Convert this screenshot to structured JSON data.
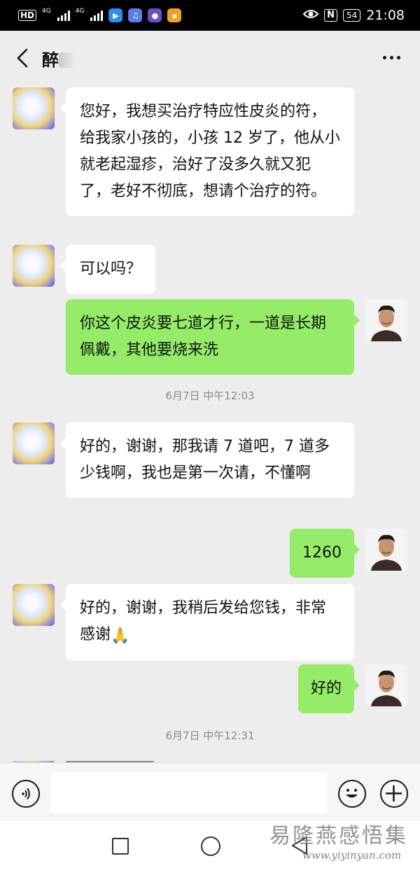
{
  "status_bar": {
    "hd": "HD",
    "net1": "4G",
    "net2": "4G",
    "nfc": "N",
    "battery": "54",
    "time": "21:08",
    "icons": [
      "hd-icon",
      "signal-icon",
      "signal-icon",
      "delivery-app-icon",
      "music-app-icon",
      "app-icon",
      "app-icon",
      "eye-icon",
      "nfc-icon",
      "battery-icon"
    ]
  },
  "header": {
    "title": "醉",
    "back_icon": "chevron-left-icon",
    "more_icon": "more-dots-icon"
  },
  "messages": [
    {
      "side": "left",
      "text": "您好，我想买治疗特应性皮炎的符，给我家小孩的，小孩 12 岁了，他从小就老起湿疹，治好了没多久就又犯了，老好不彻底，想请个治疗的符。"
    },
    {
      "side": "left",
      "text": "可以吗？"
    },
    {
      "side": "right",
      "text": "你这个皮炎要七道才行，一道是长期佩戴，其他要烧来洗"
    },
    {
      "side": "left",
      "text": "好的，谢谢，那我请 7 道吧，7 道多少钱啊，我也是第一次请，不懂啊"
    },
    {
      "side": "right",
      "text": "1260"
    },
    {
      "side": "left",
      "text": "好的，谢谢，我稍后发给您钱，非常感谢"
    },
    {
      "side": "right",
      "text": "好的"
    }
  ],
  "timestamps": [
    "6月7日 中午12:03",
    "6月7日 中午12:31"
  ],
  "emoji": "🙏",
  "input_bar": {
    "value": "",
    "voice_icon": "voice-icon",
    "emoji_icon": "smiley-icon",
    "plus_icon": "plus-icon"
  },
  "nav_bar": {
    "icons": [
      "recent-apps-icon",
      "home-icon",
      "back-triangle-icon"
    ]
  },
  "watermark": {
    "title": "易隆燕感悟集",
    "url": "www.yiyinyan.com"
  },
  "colors": {
    "chat_bg": "#ededed",
    "bubble_left": "#ffffff",
    "bubble_right": "#95ec69",
    "status_bar_bg": "#000000",
    "timestamp_text": "#8a8a8a"
  }
}
